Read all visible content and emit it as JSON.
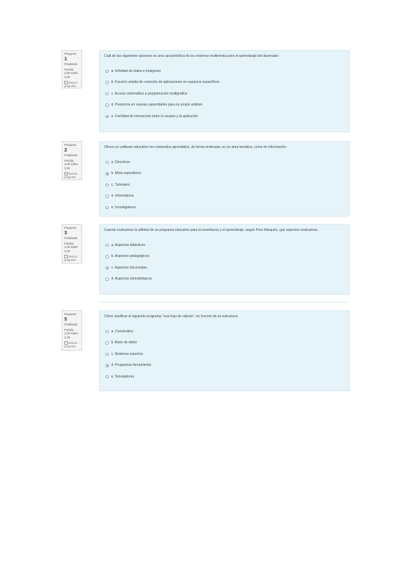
{
  "questions": [
    {
      "title": "Pregunta",
      "number": "1",
      "state": "Finalizado",
      "grade": "Puntúa 2,00 sobre 2,00",
      "flag": "Marcar pregunta",
      "text": "Cuál de las siguientes opciones es una característica de los entornos multimedia para el aprendizaje del alumnado:",
      "selected": 4,
      "options": [
        "a. Infinidad de datos e imágenes",
        "b. Función amplia de conexión de aplicaciones en espacios específicos",
        "c. Acceso sistemático a programación multigráfica",
        "d. Presencia en nuevas capacidades para su propio análisis",
        "e. Facilidad de interacción entre el usuario y la aplicación"
      ]
    },
    {
      "title": "Pregunta",
      "number": "2",
      "state": "Finalizado",
      "grade": "Puntúa 2,00 sobre 2,00",
      "flag": "Marcar pregunta",
      "text": "Ofrece un software educativo los contenidos aprendidos, de forma ordenada, en un área temática, como de información:",
      "selected": 1,
      "options": [
        "a. Directivos",
        "b. Meta expositores",
        "c. Tutoriales",
        "d. Informativos",
        "e. Investigativos"
      ]
    },
    {
      "title": "Pregunta",
      "number": "3",
      "state": "Finalizado",
      "grade": "Puntúa 2,00 sobre 2,00",
      "flag": "Marcar pregunta",
      "text": "Cuando evaluamos la utilidad de un programa educativo para la enseñanza y el aprendizaje, según Pere Marqués, qué aspectos evaluamos:",
      "selected": 2,
      "options": [
        "a. Aspectos didácticos",
        "b. Aspectos pedagógicos",
        "c. Aspectos funcionales",
        "d. Aspectos metodológicos"
      ]
    },
    {
      "title": "Pregunta",
      "number": "5",
      "state": "Finalizado",
      "grade": "Puntúa 2,00 sobre 2,00",
      "flag": "Marcar pregunta",
      "text": "Cómo clasificar el siguiente programa \"una hoja de cálculo\", en función de su estructura:",
      "selected": 3,
      "options": [
        "a. Construidos",
        "b. Base de datos",
        "c. Sistemas expertos",
        "d. Programas herramienta",
        "e. Simuladores"
      ]
    }
  ]
}
